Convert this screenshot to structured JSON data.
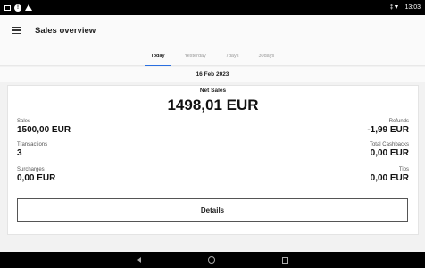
{
  "status_bar": {
    "time": "13:03",
    "signal_label": "‡▼"
  },
  "app_bar": {
    "title": "Sales overview"
  },
  "tabs": [
    {
      "label": "Today",
      "active": true
    },
    {
      "label": "Yesterday",
      "active": false
    },
    {
      "label": "7days",
      "active": false
    },
    {
      "label": "30days",
      "active": false
    }
  ],
  "date": "16 Feb 2023",
  "summary": {
    "net_sales_label": "Net Sales",
    "net_sales_value": "1498,01 EUR",
    "sales_label": "Sales",
    "sales_value": "1500,00 EUR",
    "transactions_label": "Transactions",
    "transactions_value": "3",
    "surcharges_label": "Surcharges",
    "surcharges_value": "0,00 EUR",
    "refunds_label": "Refunds",
    "refunds_value": "-1,99 EUR",
    "cashbacks_label": "Total Cashbacks",
    "cashbacks_value": "0,00 EUR",
    "tips_label": "Tips",
    "tips_value": "0,00 EUR"
  },
  "details_button": "Details",
  "colors": {
    "accent": "#2a6fe0",
    "status_bar": "#000000",
    "background": "#f2f2f2"
  }
}
